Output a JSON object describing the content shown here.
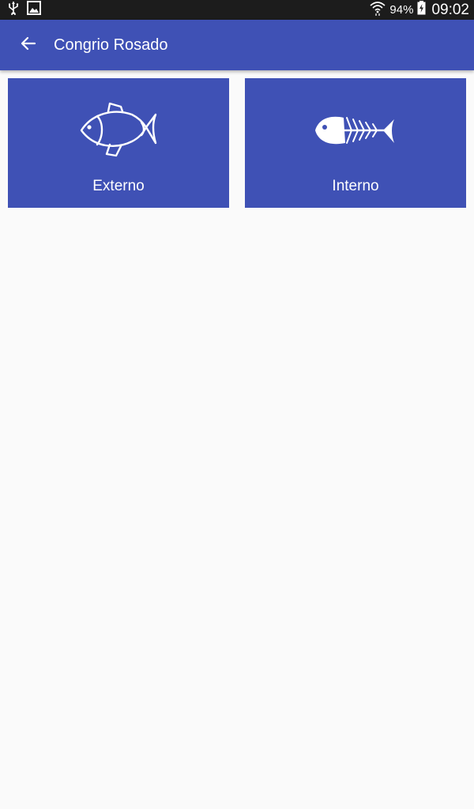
{
  "colors": {
    "primary": "#3f51b5",
    "status_bar": "#1c1c1c",
    "background": "#fafafa",
    "on_primary": "#ffffff"
  },
  "status_bar": {
    "left_icons": [
      "usb-icon",
      "image-icon"
    ],
    "right_icons": [
      "wifi-icon",
      "battery-charging-icon"
    ],
    "battery": "94%",
    "time": "09:02"
  },
  "app_bar": {
    "back_icon": "arrow-back-icon",
    "title": "Congrio Rosado"
  },
  "tiles": [
    {
      "label": "Externo",
      "icon": "fish-outline-icon"
    },
    {
      "label": "Interno",
      "icon": "fish-skeleton-icon"
    }
  ]
}
